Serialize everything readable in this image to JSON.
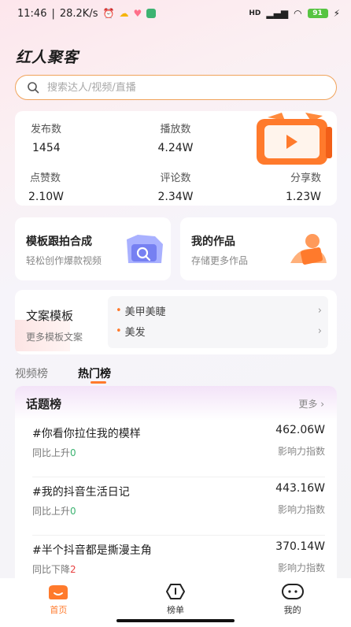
{
  "status_bar": {
    "time": "11:46",
    "speed": "28.2K/s",
    "network": "HD",
    "battery": "91"
  },
  "brand": "红人聚客",
  "search": {
    "placeholder": "搜索达人/视频/直播"
  },
  "stats": [
    {
      "label": "发布数",
      "value": "1454"
    },
    {
      "label": "播放数",
      "value": "4.24W"
    },
    {
      "label": "点赞数",
      "value": "2.10W"
    },
    {
      "label": "评论数",
      "value": "2.34W"
    },
    {
      "label": "分享数",
      "value": "1.23W"
    }
  ],
  "cards": {
    "template": {
      "title": "模板跟拍合成",
      "subtitle": "轻松创作爆款视频"
    },
    "works": {
      "title": "我的作品",
      "subtitle": "存储更多作品"
    }
  },
  "copy_templates": {
    "title": "文案模板",
    "subtitle": "更多模板文案",
    "items": [
      "美甲美睫",
      "美发"
    ]
  },
  "tabs": [
    "视频榜",
    "热门榜"
  ],
  "topics": {
    "title": "话题榜",
    "more": "更多",
    "rows": [
      {
        "name": "#你看你拉住我的模样",
        "trend_label": "同比上升",
        "trend_value": "0",
        "score": "462.06W",
        "score_label": "影响力指数"
      },
      {
        "name": "#我的抖音生活日记",
        "trend_label": "同比上升",
        "trend_value": "0",
        "score": "443.16W",
        "score_label": "影响力指数"
      },
      {
        "name": "#半个抖音都是撕漫主角",
        "trend_label": "同比下降",
        "trend_value": "2",
        "score": "370.14W",
        "score_label": "影响力指数"
      }
    ]
  },
  "tabbar": [
    {
      "label": "首页",
      "icon": "home-icon",
      "active": true
    },
    {
      "label": "榜单",
      "icon": "rank-icon",
      "active": false
    },
    {
      "label": "我的",
      "icon": "profile-icon",
      "active": false
    }
  ],
  "colors": {
    "accent": "#ff7a2c",
    "up": "#3cb371",
    "down": "#e84040"
  }
}
